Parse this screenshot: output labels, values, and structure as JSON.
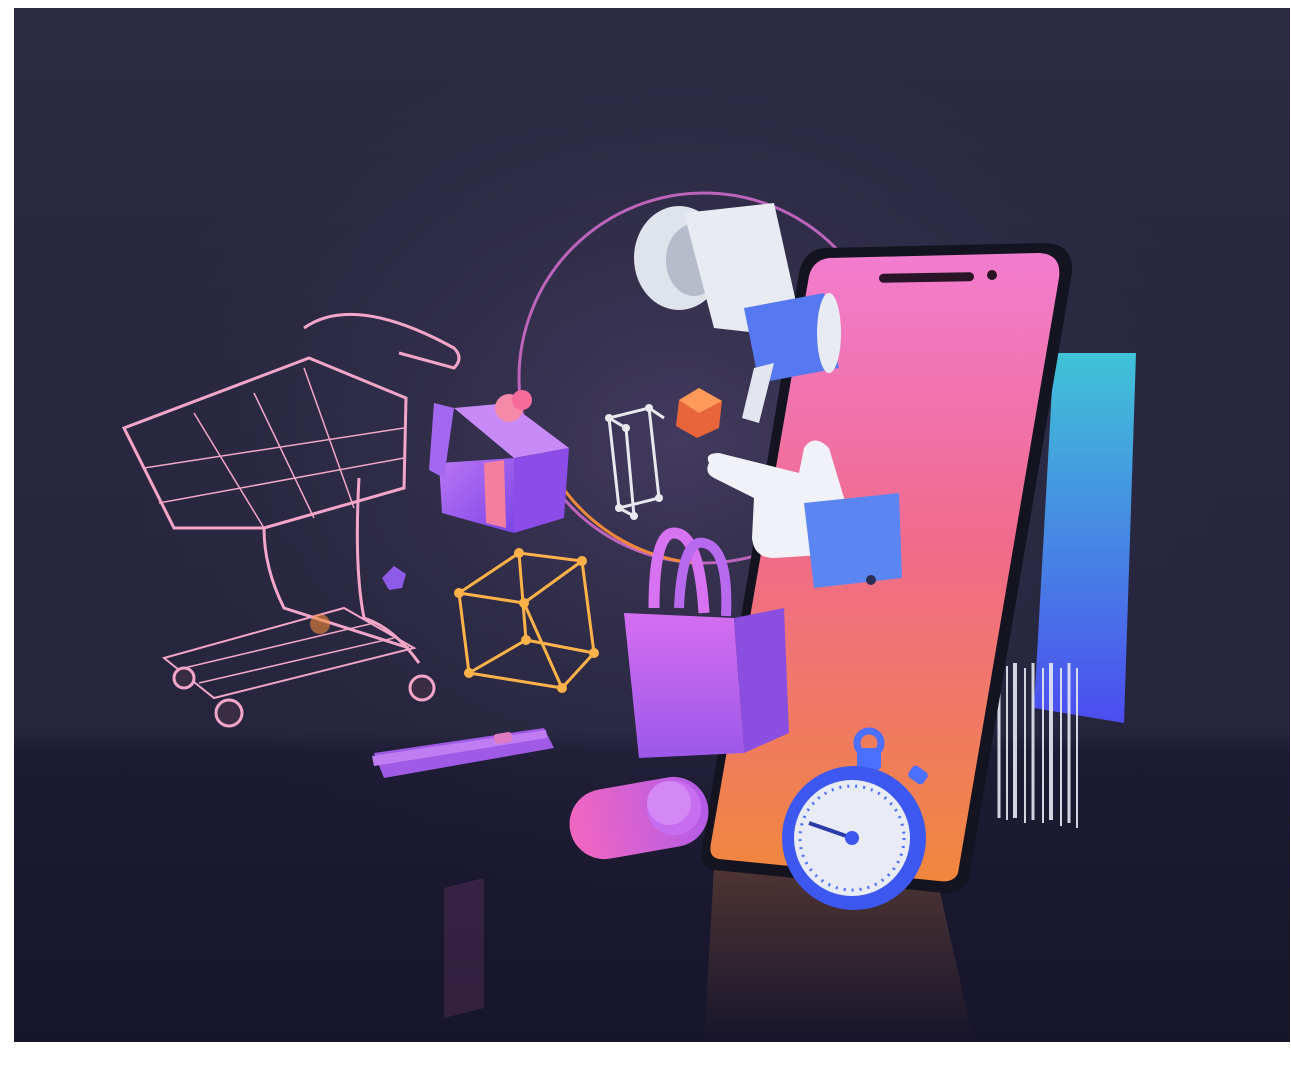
{
  "scene": {
    "colors": {
      "background_top": "#2a2940",
      "background_floor": "#1b1a31",
      "phone_gradient_top": "#f06fc0",
      "phone_gradient_bottom": "#f08a3a",
      "accent_purple": "#9c5cf0",
      "accent_blue": "#4b6fff",
      "wire_pink": "#f3a6c8",
      "wire_orange": "#ffb24a",
      "card_teal": "#3ec7d6"
    },
    "objects": [
      "shopping-cart-icon",
      "gift-box-icon",
      "wireframe-cube-icon",
      "megaphone-icon",
      "pointing-hand-icon",
      "shopping-bag-icon",
      "stopwatch-icon",
      "smartphone-icon",
      "credit-card-icon",
      "barcode-icon",
      "toggle-switch-icon",
      "slider-bar-icon"
    ]
  }
}
